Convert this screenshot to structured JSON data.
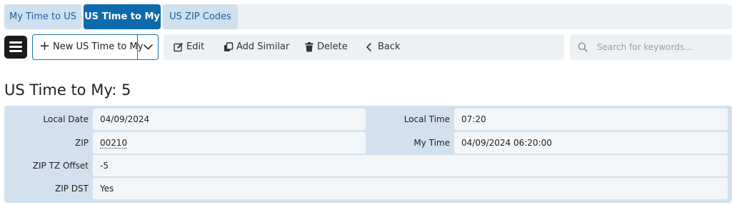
{
  "tabs": [
    {
      "label": "My Time to US"
    },
    {
      "label": "US Time to My"
    },
    {
      "label": "US ZIP Codes"
    }
  ],
  "toolbar": {
    "new_label": "New US Time to My",
    "edit_label": "Edit",
    "add_similar_label": "Add Similar",
    "delete_label": "Delete",
    "back_label": "Back"
  },
  "search": {
    "placeholder": "Search for keywords...",
    "value": ""
  },
  "page": {
    "title": "US Time to My: 5"
  },
  "fields": {
    "local_date": {
      "label": "Local Date",
      "value": "04/09/2024"
    },
    "local_time": {
      "label": "Local Time",
      "value": "07:20"
    },
    "zip": {
      "label": "ZIP",
      "value": "00210"
    },
    "my_time": {
      "label": "My Time",
      "value": "04/09/2024 06:20:00"
    },
    "zip_tz_offset": {
      "label": "ZIP TZ Offset",
      "value": "-5"
    },
    "zip_dst": {
      "label": "ZIP DST",
      "value": "Yes"
    }
  },
  "colors": {
    "active_tab": "#0d6aad",
    "inactive_tab": "#cfe0ee",
    "panel": "#d3e1ee",
    "field_bg": "#f3f6f9",
    "primary_border": "#1f6fb2"
  },
  "icons": {
    "menu": "hamburger-menu-icon",
    "new": "plus-icon",
    "caret": "chevron-down-icon",
    "edit": "edit-icon",
    "add_similar": "copy-icon",
    "delete": "trash-icon",
    "back": "chevron-left-icon",
    "search": "search-icon"
  }
}
